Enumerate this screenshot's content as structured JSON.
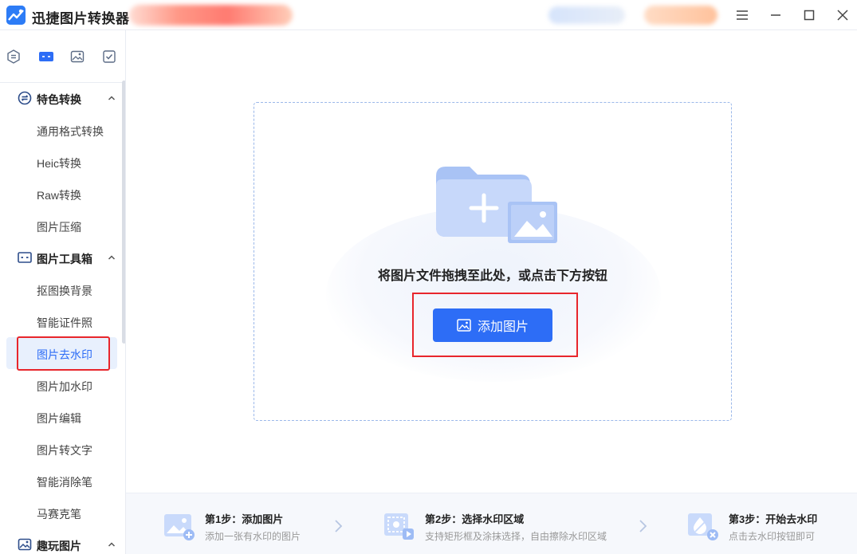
{
  "app": {
    "title": "迅捷图片转换器"
  },
  "sidebar": {
    "sections": [
      {
        "label": "特色转换",
        "items": [
          "通用格式转换",
          "Heic转换",
          "Raw转换",
          "图片压缩"
        ]
      },
      {
        "label": "图片工具箱",
        "items": [
          "抠图换背景",
          "智能证件照",
          "图片去水印",
          "图片加水印",
          "图片编辑",
          "图片转文字",
          "智能消除笔",
          "马赛克笔"
        ]
      },
      {
        "label": "趣玩图片",
        "items": []
      }
    ],
    "active_item": "图片去水印"
  },
  "main": {
    "drop_text": "将图片文件拖拽至此处，或点击下方按钮",
    "add_button_label": "添加图片"
  },
  "steps": [
    {
      "title": "第1步：添加图片",
      "desc": "添加一张有水印的图片"
    },
    {
      "title": "第2步：选择水印区域",
      "desc": "支持矩形框及涂抹选择，自由擦除水印区域"
    },
    {
      "title": "第3步：开始去水印",
      "desc": "点击去水印按钮即可"
    }
  ],
  "colors": {
    "accent": "#2d6df6",
    "highlight_border": "#e8262c",
    "active_bg": "#e8f0fd"
  }
}
